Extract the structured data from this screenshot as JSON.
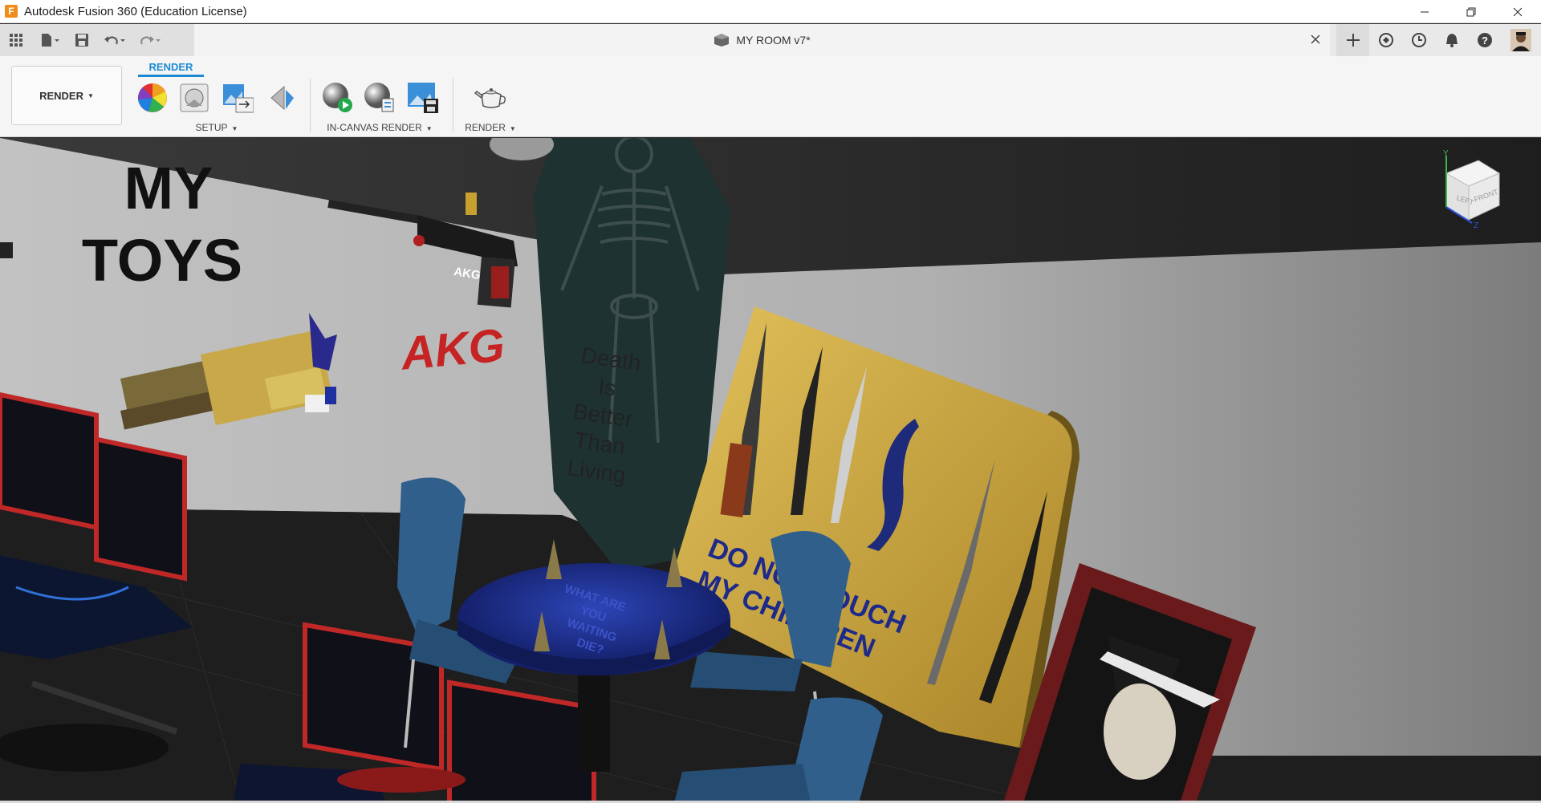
{
  "window": {
    "title": "Autodesk Fusion 360 (Education License)",
    "logo_letter": "F"
  },
  "document": {
    "title": "MY ROOM v7*"
  },
  "toolbar": {
    "workspace_label": "RENDER",
    "active_tab": "RENDER",
    "groups": {
      "setup": "SETUP",
      "in_canvas": "IN-CANVAS RENDER",
      "render": "RENDER"
    }
  },
  "scene": {
    "wall_sign": [
      "MY",
      "TOYS"
    ],
    "gun_label": "AKG",
    "wall_logo": "AKG",
    "coffin_text": [
      "Death",
      "Is",
      "Better",
      "Than",
      "Living"
    ],
    "board_text": [
      "DO NOT TOUCH",
      "MY CHILDREN"
    ],
    "table_text": [
      "WHAT ARE",
      "YOU",
      "WAITING",
      "DIE?"
    ]
  },
  "viewcube": {
    "left": "LEFT",
    "front": "FRONT",
    "axis_y": "Y",
    "axis_z": "Z"
  },
  "colors": {
    "accent": "#1b89d4",
    "wall": "#b8b8b8",
    "floor": "#1e1e1e",
    "board": "#c9a23a",
    "table": "#1c2f8f",
    "chair": "#2f5f8a"
  }
}
